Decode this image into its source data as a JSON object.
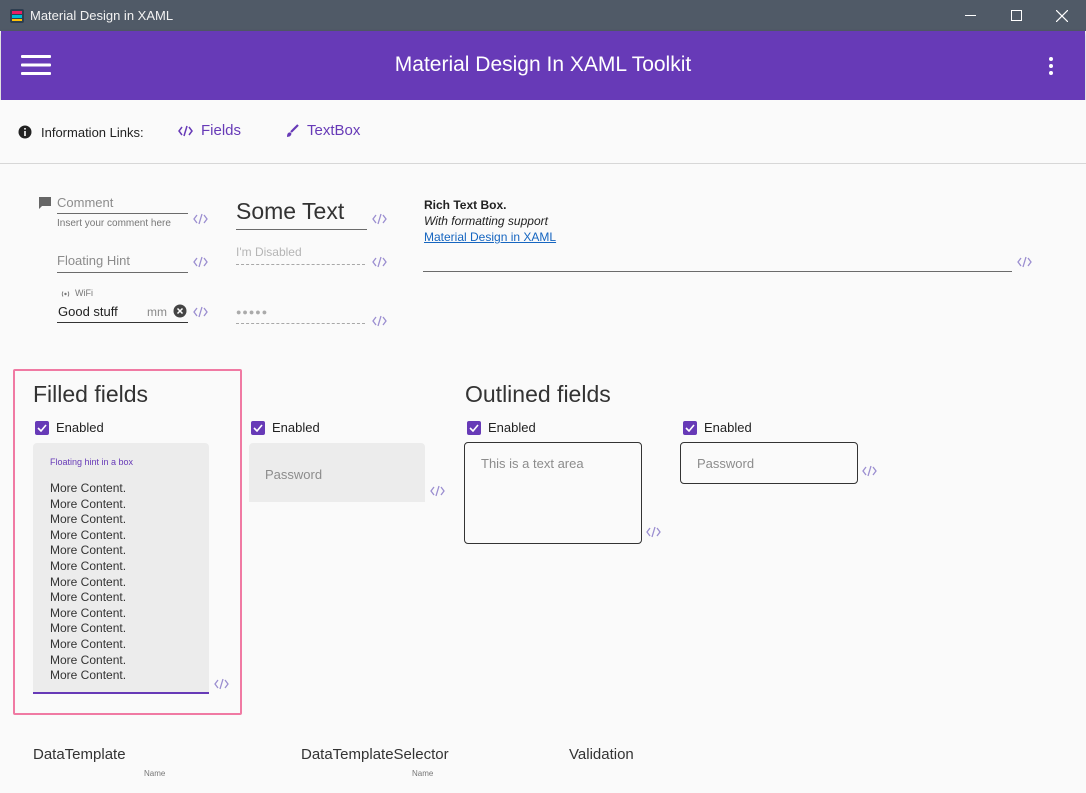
{
  "window": {
    "title": "Material Design in XAML",
    "controls": [
      "minimize-icon",
      "maximize-icon",
      "close-icon"
    ]
  },
  "appbar": {
    "title": "Material Design In XAML Toolkit",
    "menu_icon": "hamburger-icon",
    "overflow_icon": "more-vert-icon"
  },
  "info_links": {
    "label": "Information Links:",
    "links": [
      {
        "label": "Fields",
        "icon": "code-icon"
      },
      {
        "label": "TextBox",
        "icon": "brush-icon"
      }
    ]
  },
  "textfields": {
    "comment_hint": "Comment",
    "comment_helper": "Insert your comment here",
    "floating_hint": "Floating Hint",
    "wifi_label": "WiFi",
    "wifi_value": "Good stuff",
    "wifi_suffix": "mm",
    "some_text": "Some Text",
    "disabled_hint": "I'm Disabled",
    "password_mask": "●●●●●"
  },
  "rich_text": {
    "title": "Rich Text Box.",
    "subtitle": "With formatting support",
    "link": "Material Design in XAML"
  },
  "filled": {
    "title": "Filled fields",
    "enabled_label_1": "Enabled",
    "enabled_label_2": "Enabled",
    "hint_in_box": "Floating hint in a box",
    "content_lines": [
      "More Content.",
      "More Content.",
      "More Content.",
      "More Content.",
      "More Content.",
      "More Content.",
      "More Content.",
      "More Content.",
      "More Content.",
      "More Content.",
      "More Content.",
      "More Content.",
      "More Content."
    ],
    "password_hint": "Password"
  },
  "outlined": {
    "title": "Outlined fields",
    "enabled_label_1": "Enabled",
    "enabled_label_2": "Enabled",
    "textarea_hint": "This is a text area",
    "password_hint": "Password"
  },
  "bottom": {
    "data_template": "DataTemplate",
    "data_template_selector": "DataTemplateSelector",
    "validation": "Validation",
    "name_label_1": "Name",
    "name_label_2": "Name"
  },
  "colors": {
    "primary": "#673ab7",
    "titlebar": "#505a67",
    "highlight": "#f07aa3"
  }
}
